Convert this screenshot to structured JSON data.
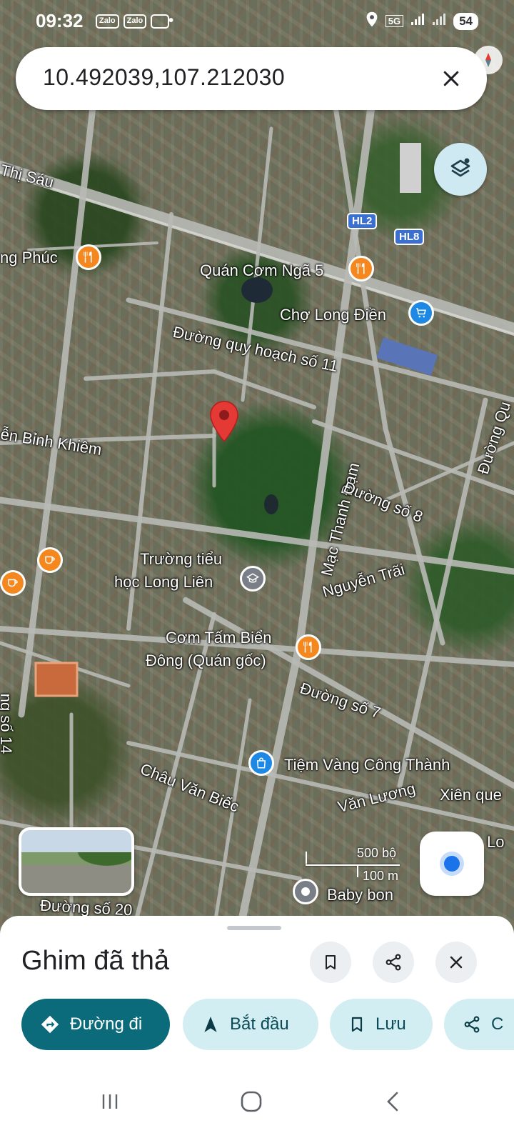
{
  "status_bar": {
    "time": "09:32",
    "apps": [
      "Zalo",
      "Zalo"
    ],
    "network": "5G",
    "battery": "54"
  },
  "search": {
    "query": "10.492039,107.212030"
  },
  "map": {
    "labels": {
      "thi_sau": "Thị Sáu",
      "ng_phuc": "ng Phúc",
      "quan_com_nga5": "Quán Cơm Ngã 5",
      "cho_long_dien": "Chợ Long Điền",
      "duong_qh_11": "Đường quy hoạch số 11",
      "binh_khiem": "ễn Bỉnh Khiêm",
      "mac_thanh_dam": "Mạc Thanh Đạm",
      "duong_so_8": "Đường số 8",
      "duong_qu": "Đường Qu",
      "truong_tieu_hoc_1": "Trường tiểu",
      "truong_tieu_hoc_2": "học Long Liên",
      "nguyen_trai": "Nguyễn Trãi",
      "com_tam_1": "Cơm Tấm Biển",
      "com_tam_2": "Đông (Quán gốc)",
      "duong_so_7": "Đường số 7",
      "tiem_vang": "Tiệm Vàng Công Thành",
      "van_luong": "Văn Lương",
      "xien_que": "Xiên que",
      "chau_van_biec": "Châu Văn Biếc",
      "duong_so_20": "Đường số 20",
      "baby_bon": "Baby bon",
      "so_14": "ng số 14",
      "lo": "Lo"
    },
    "route_shields": [
      "HL2",
      "HL8"
    ],
    "scale": {
      "imperial": "500 bộ",
      "metric": "100 m"
    },
    "colors": {
      "pin": "#e53935",
      "food_poi": "#f5871f",
      "shop_poi": "#1e88e5"
    }
  },
  "sheet": {
    "title": "Ghim đã thả",
    "actions": {
      "directions": "Đường đi",
      "start": "Bắt đầu",
      "save": "Lưu",
      "share_partial": "C"
    },
    "accent": "#0b6b7a"
  }
}
